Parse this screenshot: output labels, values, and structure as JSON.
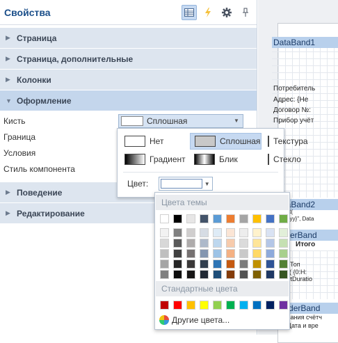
{
  "panel": {
    "title": "Свойства",
    "icons": [
      "grid-view-icon",
      "lightning-icon",
      "gear-icon",
      "pin-icon"
    ]
  },
  "sections": [
    {
      "label": "Страница",
      "expanded": false
    },
    {
      "label": "Страница, дополнительные",
      "expanded": false
    },
    {
      "label": "Колонки",
      "expanded": false
    },
    {
      "label": "Оформление",
      "expanded": true
    },
    {
      "label": "Поведение",
      "expanded": false
    },
    {
      "label": "Редактирование",
      "expanded": false
    }
  ],
  "properties": {
    "brush": {
      "name": "Кисть",
      "value": "Сплошная"
    },
    "border": {
      "name": "Граница"
    },
    "conditions": {
      "name": "Условия"
    },
    "component_style": {
      "name": "Стиль компонента"
    }
  },
  "brush_popup": {
    "types": [
      {
        "label": "Нет",
        "selected": false
      },
      {
        "label": "Сплошная",
        "selected": true
      },
      {
        "label": "Текстура",
        "selected": false
      },
      {
        "label": "Градиент",
        "selected": false
      },
      {
        "label": "Блик",
        "selected": false
      },
      {
        "label": "Стекло",
        "selected": false
      }
    ],
    "color_label": "Цвет:"
  },
  "palette": {
    "theme_title": "Цвета темы",
    "standard_title": "Стандартные цвета",
    "more_colors": "Другие цвета...",
    "theme_top": [
      "#ffffff",
      "#000000",
      "#e7e6e6",
      "#44546a",
      "#5b9bd5",
      "#ed7d31",
      "#a5a5a5",
      "#ffc000",
      "#4472c4",
      "#70ad47"
    ],
    "theme_shades": [
      [
        "#f2f2f2",
        "#808080",
        "#d0cece",
        "#d6dce4",
        "#deebf6",
        "#fbe5d5",
        "#ededed",
        "#fff2cc",
        "#d9e2f3",
        "#e2efd9"
      ],
      [
        "#d8d8d8",
        "#595959",
        "#aeabab",
        "#adb9ca",
        "#bdd7ee",
        "#f7cbac",
        "#dbdbdb",
        "#fee599",
        "#b4c6e7",
        "#c5e0b3"
      ],
      [
        "#bfbfbf",
        "#404040",
        "#757070",
        "#8496b0",
        "#9dc3e6",
        "#f4b183",
        "#c9c9c9",
        "#ffd966",
        "#8eaadb",
        "#a8d08d"
      ],
      [
        "#a5a5a5",
        "#262626",
        "#3a3838",
        "#323f4f",
        "#2e75b5",
        "#c55a11",
        "#7b7b7b",
        "#bf9000",
        "#2f5496",
        "#538135"
      ],
      [
        "#7f7f7f",
        "#0d0d0d",
        "#171616",
        "#222a35",
        "#1e4e79",
        "#843c0b",
        "#525252",
        "#7f6000",
        "#1f3864",
        "#375623"
      ]
    ],
    "standard": [
      "#c00000",
      "#ff0000",
      "#ffc000",
      "#ffff00",
      "#92d050",
      "#00b050",
      "#00b0f0",
      "#0070c0",
      "#002060",
      "#7030a0"
    ]
  },
  "designer": {
    "bands": [
      {
        "name": "DataBand1"
      },
      {
        "name": "DataBand2"
      },
      {
        "name": "FooterBand"
      },
      {
        "name": "HeaderBand"
      }
    ],
    "lines": [
      "Потребитель",
      "Адрес: {Не",
      "Договор №:",
      "Прибор учёт",
      "Format(",
      "MM.yyyy}\", Data",
      "Итого",
      "Топ",
      "ormat( {0:H:",
      "ReportDuratio",
      "Показания счётч",
      "Дата и вре"
    ]
  }
}
